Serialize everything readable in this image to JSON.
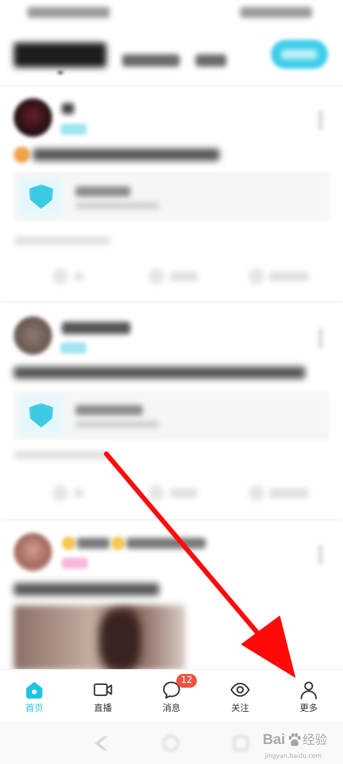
{
  "colors": {
    "accent": "#1fc4e4",
    "tab_inactive": "#333333",
    "badge": "#f05342",
    "arrow": "#ff0a0a"
  },
  "tabbar": {
    "items": [
      {
        "label": "首页",
        "icon": "home-icon",
        "active": true
      },
      {
        "label": "直播",
        "icon": "video-camera-icon",
        "active": false
      },
      {
        "label": "消息",
        "icon": "chat-bubble-icon",
        "active": false,
        "badge": "12"
      },
      {
        "label": "关注",
        "icon": "eye-icon",
        "active": false
      },
      {
        "label": "更多",
        "icon": "person-icon",
        "active": false
      }
    ]
  },
  "watermark": {
    "brand": "Bai",
    "product": "经验",
    "url": "jingyan.baidu.com"
  }
}
